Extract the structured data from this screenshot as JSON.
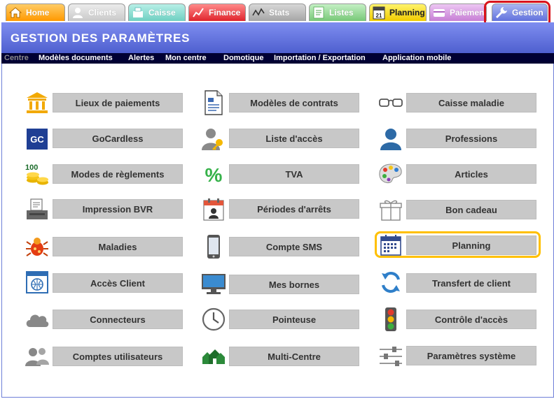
{
  "tabs": [
    {
      "id": "home",
      "label": "Home",
      "icon": "house-icon"
    },
    {
      "id": "clients",
      "label": "Clients",
      "icon": "person-icon"
    },
    {
      "id": "caisse",
      "label": "Caisse",
      "icon": "register-icon"
    },
    {
      "id": "finance",
      "label": "Finance",
      "icon": "finance-icon"
    },
    {
      "id": "stats",
      "label": "Stats",
      "icon": "stats-icon"
    },
    {
      "id": "listes",
      "label": "Listes",
      "icon": "list-icon"
    },
    {
      "id": "planning",
      "label": "Planning",
      "icon": "calendar-icon"
    },
    {
      "id": "paiements",
      "label": "Paiements",
      "icon": "payment-icon"
    },
    {
      "id": "gestion",
      "label": "Gestion",
      "icon": "wrench-icon"
    }
  ],
  "header": {
    "title": "GESTION DES PARAMÈTRES"
  },
  "subnav": [
    "Centre",
    "Modèles documents",
    "Alertes",
    "Mon centre",
    "Domotique",
    "Importation / Exportation",
    "Application mobile"
  ],
  "grid": {
    "col1": [
      "Lieux de paiements",
      "GoCardless",
      "Modes de règlements",
      "Impression BVR",
      "Maladies",
      "Accès Client",
      "Connecteurs",
      "Comptes utilisateurs"
    ],
    "col2": [
      "Modèles de contrats",
      "Liste d'accès",
      "TVA",
      "Périodes d'arrêts",
      "Compte SMS",
      "Mes bornes",
      "Pointeuse",
      "Multi-Centre"
    ],
    "col3": [
      "Caisse maladie",
      "Professions",
      "Articles",
      "Bon cadeau",
      "Planning",
      "Transfert de client",
      "Contrôle d'accès",
      "Paramètres système"
    ]
  },
  "icon_text": {
    "gocardless": "GC",
    "tva": "%",
    "modes_reglements": "100",
    "calendar_day": "21"
  },
  "colors": {
    "header_blue": "#5b6ad6",
    "subnav_navy": "#000033",
    "button_grey": "#c8c8c8",
    "highlight_red": "#d9141c",
    "highlight_yellow": "#ffc000"
  }
}
